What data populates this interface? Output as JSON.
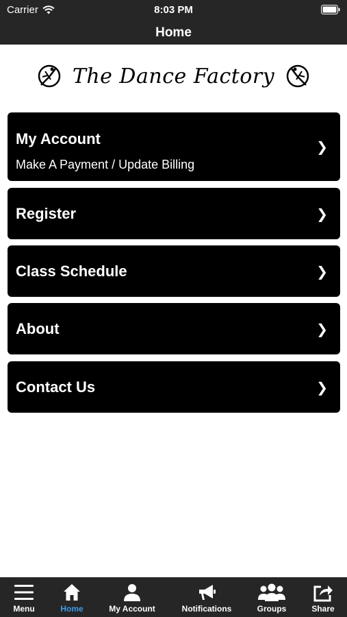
{
  "status_bar": {
    "carrier": "Carrier",
    "time": "8:03 PM"
  },
  "nav": {
    "title": "Home"
  },
  "logo": {
    "text": "The Dance Factory"
  },
  "menu": [
    {
      "title": "My Account",
      "subtitle": "Make A Payment / Update Billing"
    },
    {
      "title": "Register"
    },
    {
      "title": "Class Schedule"
    },
    {
      "title": "About"
    },
    {
      "title": "Contact Us"
    }
  ],
  "tabs": [
    {
      "label": "Menu",
      "icon": "hamburger-icon"
    },
    {
      "label": "Home",
      "icon": "home-icon",
      "active": true
    },
    {
      "label": "My Account",
      "icon": "user-icon"
    },
    {
      "label": "Notifications",
      "icon": "megaphone-icon"
    },
    {
      "label": "Groups",
      "icon": "groups-icon"
    },
    {
      "label": "Share",
      "icon": "share-icon"
    }
  ],
  "colors": {
    "bar": "#262626",
    "card": "#000000",
    "active_tab": "#3f9be6"
  }
}
